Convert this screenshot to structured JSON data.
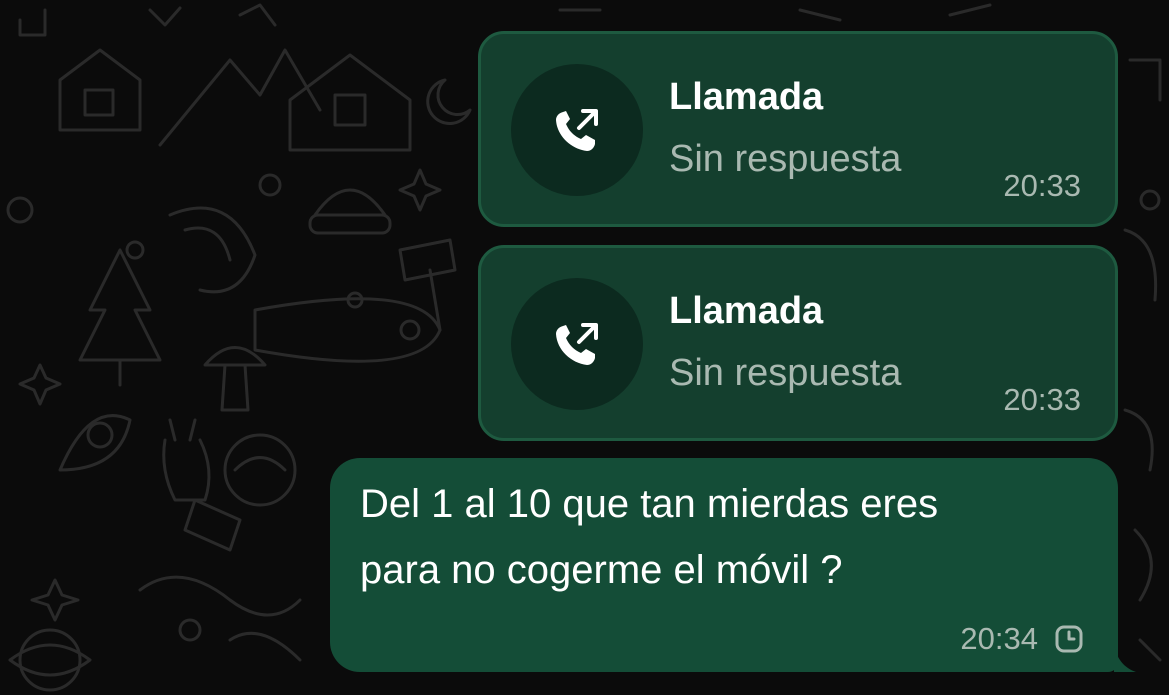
{
  "colors": {
    "background": "#0b0b0b",
    "call_bubble": "#143f2e",
    "call_bubble_border": "#1e5a40",
    "call_icon_circle": "#0c2a1f",
    "text_bubble": "#144d37",
    "secondary_text": "#a9b9b1",
    "primary_text": "#ffffff"
  },
  "messages": [
    {
      "type": "call",
      "icon": "outgoing-call-icon",
      "title": "Llamada",
      "status": "Sin respuesta",
      "time": "20:33"
    },
    {
      "type": "call",
      "icon": "outgoing-call-icon",
      "title": "Llamada",
      "status": "Sin respuesta",
      "time": "20:33"
    },
    {
      "type": "text",
      "lines": [
        "Del 1 al 10 que tan mierdas eres",
        "para no cogerme el móvil ?"
      ],
      "time": "20:34",
      "status_icon": "clock-pending-icon"
    }
  ]
}
